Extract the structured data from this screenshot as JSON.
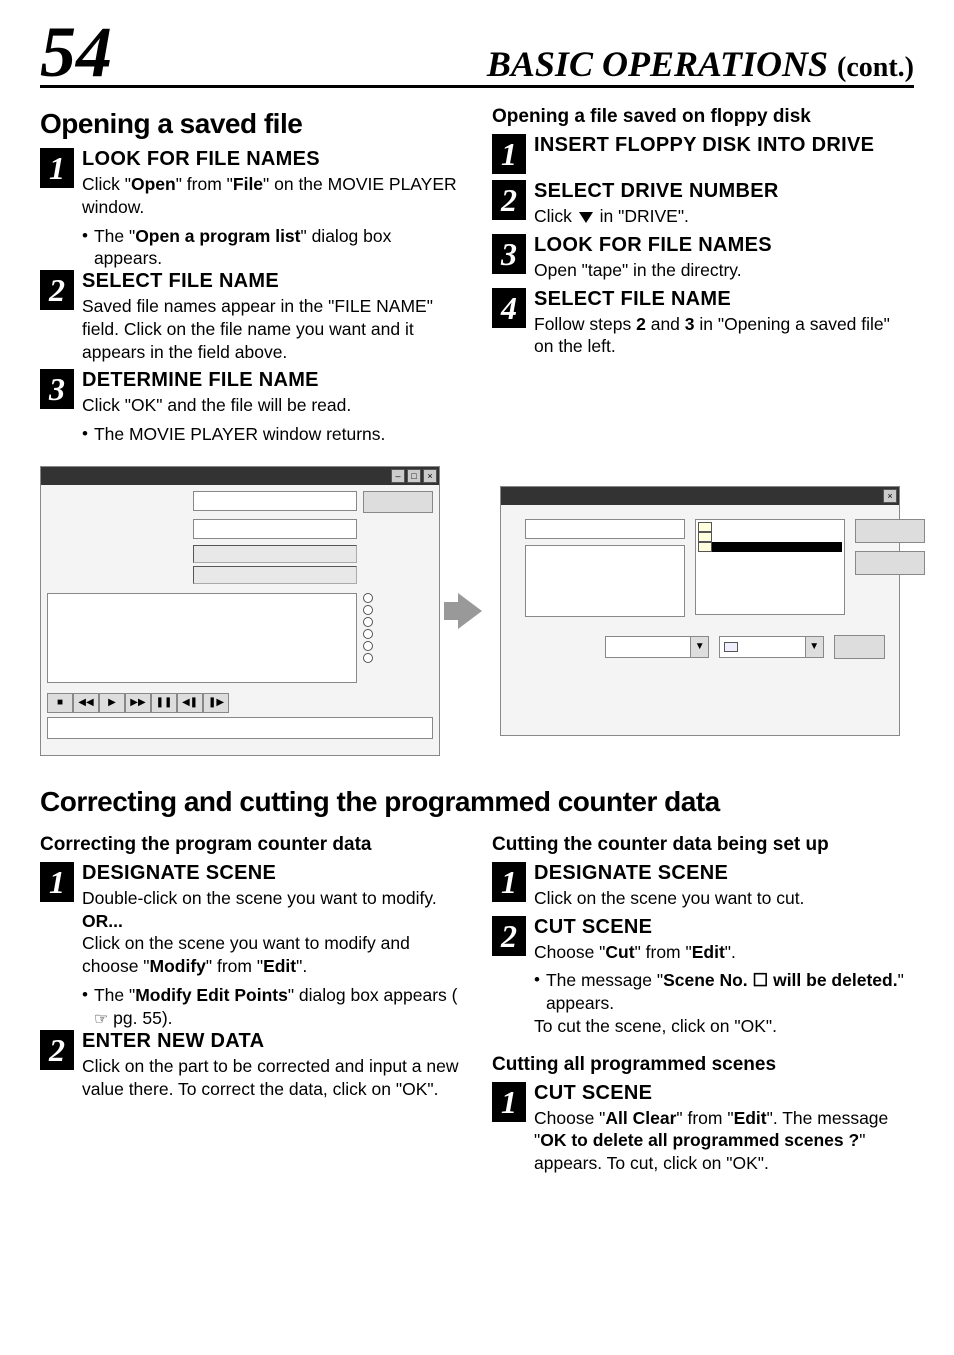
{
  "page_number": "54",
  "header": {
    "title": "BASIC OPERATIONS",
    "cont": "(cont.)"
  },
  "section1": {
    "title": "Opening a saved file",
    "left_steps": [
      {
        "num": "1",
        "title": "LOOK FOR FILE NAMES",
        "body_1": "Click \"",
        "body_1b": "Open",
        "body_1c": "\" from \"",
        "body_1d": "File",
        "body_1e": "\" on the MOVIE PLAYER window.",
        "bullet_1a": "The \"",
        "bullet_1b": "Open a program list",
        "bullet_1c": "\" dialog box appears."
      },
      {
        "num": "2",
        "title": "SELECT FILE NAME",
        "body": "Saved file names appear in the \"FILE NAME\" field. Click on the file name you want and it appears in the field above."
      },
      {
        "num": "3",
        "title": "DETERMINE FILE NAME",
        "body": "Click \"OK\" and the file will be read.",
        "bullet": "The MOVIE PLAYER window returns."
      }
    ],
    "right_heading": "Opening a file saved on floppy disk",
    "right_steps": [
      {
        "num": "1",
        "title": "INSERT FLOPPY DISK INTO DRIVE"
      },
      {
        "num": "2",
        "title": "SELECT DRIVE NUMBER",
        "body_a": "Click ",
        "body_b": " in \"DRIVE\"."
      },
      {
        "num": "3",
        "title": "LOOK FOR FILE NAMES",
        "body": "Open \"tape\" in the directry."
      },
      {
        "num": "4",
        "title": "SELECT FILE NAME",
        "body_a": "Follow steps ",
        "body_b": "2",
        "body_c": " and ",
        "body_d": "3",
        "body_e": " in \"Opening a saved file\" on the left."
      }
    ]
  },
  "section2": {
    "title": "Correcting and cutting the programmed counter data",
    "left_heading": "Correcting the program counter data",
    "left_steps": [
      {
        "num": "1",
        "title": "DESIGNATE SCENE",
        "body_1": "Double-click on the scene you want to modify.",
        "or": "OR...",
        "body_2a": "Click on the scene you want to modify and choose \"",
        "body_2b": "Modify",
        "body_2c": "\" from \"",
        "body_2d": "Edit",
        "body_2e": "\".",
        "bullet_a": "The \"",
        "bullet_b": "Modify Edit Points",
        "bullet_c": "\" dialog box appears (",
        "bullet_d": " pg. 55)."
      },
      {
        "num": "2",
        "title": "ENTER NEW DATA",
        "body": "Click on the part to be corrected and input a new value there. To correct the data, click on \"OK\"."
      }
    ],
    "right_heading_1": "Cutting the counter data being set up",
    "right_steps_1": [
      {
        "num": "1",
        "title": "DESIGNATE SCENE",
        "body": "Click on the scene you want to cut."
      },
      {
        "num": "2",
        "title": "CUT SCENE",
        "body_a": "Choose \"",
        "body_b": "Cut",
        "body_c": "\" from \"",
        "body_d": "Edit",
        "body_e": "\".",
        "bullet_a": "The message \"",
        "bullet_b": "Scene No. ☐ will be deleted.",
        "bullet_c": "\" appears.",
        "body_2": "To cut the scene, click on \"OK\"."
      }
    ],
    "right_heading_2": "Cutting all programmed scenes",
    "right_steps_2": [
      {
        "num": "1",
        "title": "CUT SCENE",
        "body_a": "Choose \"",
        "body_b": "All Clear",
        "body_c": "\" from \"",
        "body_d": "Edit",
        "body_e": "\". The message \"",
        "body_f": "OK to delete all programmed scenes ?",
        "body_g": "\" appears. To cut, click on \"OK\"."
      }
    ]
  },
  "transport_icons": [
    "■",
    "◀◀",
    "▶",
    "▶▶",
    "❚❚",
    "◀❚",
    "❚▶"
  ]
}
